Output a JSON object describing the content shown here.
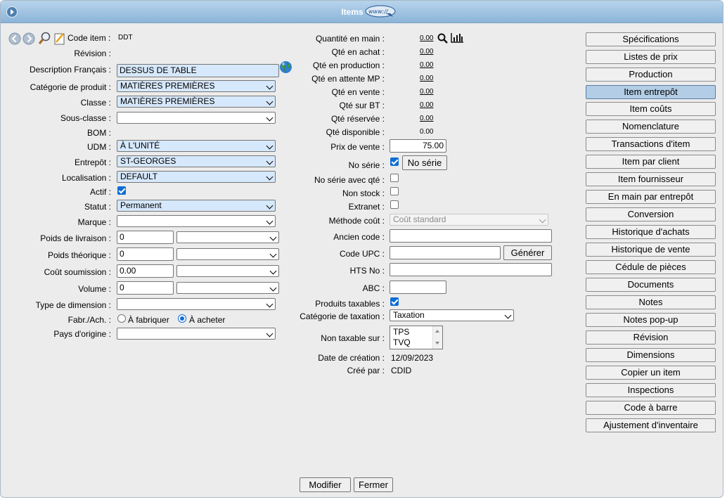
{
  "window": {
    "title": "Items",
    "logo_text": "www://"
  },
  "left": {
    "code_item_label": "Code item :",
    "code_item_value": "DDT",
    "revision_label": "Révision :",
    "description_label": "Description Français :",
    "description_value": "DESSUS DE TABLE",
    "categorie_label": "Catégorie de produit :",
    "categorie_value": "MATIÈRES PREMIÈRES",
    "classe_label": "Classe :",
    "classe_value": "MATIÈRES PREMIÈRES",
    "sous_classe_label": "Sous-classe :",
    "sous_classe_value": "",
    "bom_label": "BOM :",
    "udm_label": "UDM :",
    "udm_value": "À L'UNITÉ",
    "entrepot_label": "Entrepôt :",
    "entrepot_value": "ST-GEORGES",
    "localisation_label": "Localisation :",
    "localisation_value": "DEFAULT",
    "actif_label": "Actif :",
    "statut_label": "Statut :",
    "statut_value": "Permanent",
    "marque_label": "Marque :",
    "poids_livraison_label": "Poids de livraison :",
    "poids_livraison_value": "0",
    "poids_theorique_label": "Poids théorique :",
    "poids_theorique_value": "0",
    "cout_soumission_label": "Coût soumission :",
    "cout_soumission_value": "0.00",
    "volume_label": "Volume :",
    "volume_value": "0",
    "type_dimension_label": "Type de dimension :",
    "fabr_label": "Fabr./Ach. :",
    "fabriquer_label": "À fabriquer",
    "acheter_label": "À acheter",
    "pays_label": "Pays d'origine :"
  },
  "middle": {
    "qte_main_label": "Quantité en main :",
    "qte_main_value": "0.00",
    "qte_achat_label": "Qté en achat :",
    "qte_achat_value": "0.00",
    "qte_production_label": "Qté en production :",
    "qte_production_value": "0.00",
    "qte_attente_label": "Qté en attente MP :",
    "qte_attente_value": "0.00",
    "qte_vente_label": "Qté en vente :",
    "qte_vente_value": "0.00",
    "qte_bt_label": "Qté sur BT :",
    "qte_bt_value": "0.00",
    "qte_reservee_label": "Qté réservée :",
    "qte_reservee_value": "0.00",
    "qte_disponible_label": "Qté disponible :",
    "qte_disponible_value": "0.00",
    "prix_vente_label": "Prix de vente :",
    "prix_vente_value": "75.00",
    "no_serie_label": "No série :",
    "no_serie_button": "No série",
    "no_serie_qte_label": "No série avec qté :",
    "non_stock_label": "Non stock :",
    "extranet_label": "Extranet :",
    "methode_cout_label": "Méthode coût :",
    "methode_cout_value": "Coût standard",
    "ancien_code_label": "Ancien code :",
    "code_upc_label": "Code UPC :",
    "generer_button": "Générer",
    "hts_label": "HTS No :",
    "abc_label": "ABC :",
    "produits_taxables_label": "Produits taxables :",
    "categorie_taxation_label": "Catégorie de taxation :",
    "categorie_taxation_value": "Taxation",
    "non_taxable_label": "Non taxable sur :",
    "non_taxable_options": [
      "TPS",
      "TVQ"
    ],
    "date_creation_label": "Date de création :",
    "date_creation_value": "12/09/2023",
    "cree_par_label": "Créé par :",
    "cree_par_value": "CDID"
  },
  "right_buttons": [
    "Spécifications",
    "Listes de prix",
    "Production",
    "Item entrepôt",
    "Item coûts",
    "Nomenclature",
    "Transactions d'item",
    "Item par client",
    "Item fournisseur",
    "En main par entrepôt",
    "Conversion",
    "Historique d'achats",
    "Historique de vente",
    "Cédule de pièces",
    "Documents",
    "Notes",
    "Notes pop-up",
    "Révision",
    "Dimensions",
    "Copier un item",
    "Inspections",
    "Code à barre",
    "Ajustement d'inventaire"
  ],
  "right_active_index": 3,
  "footer": {
    "modifier": "Modifier",
    "fermer": "Fermer"
  },
  "colors": {
    "titlebar": "#9fc3e3",
    "field_highlight": "#d6e8fb",
    "active_button": "#b3cde6"
  },
  "icons": [
    "nav-arrow-icon",
    "www-logo-icon",
    "previous-icon",
    "next-icon",
    "search-icon",
    "edit-icon",
    "globe-icon",
    "magnifier-icon",
    "chart-icon"
  ]
}
